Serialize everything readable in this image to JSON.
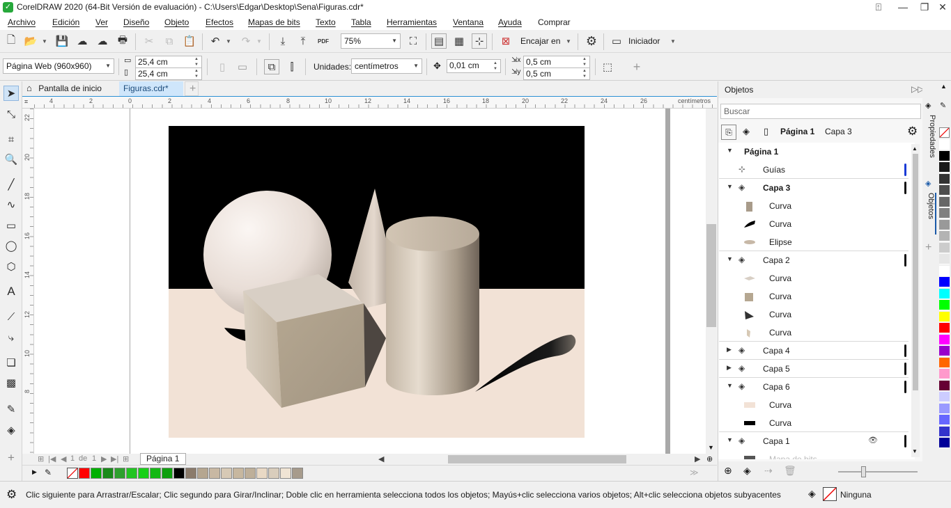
{
  "window": {
    "title": "CorelDRAW 2020 (64-Bit Versión de evaluación) - C:\\Users\\Edgar\\Desktop\\Sena\\Figuras.cdr*"
  },
  "menu": [
    "Archivo",
    "Edición",
    "Ver",
    "Diseño",
    "Objeto",
    "Efectos",
    "Mapas de bits",
    "Texto",
    "Tabla",
    "Herramientas",
    "Ventana",
    "Ayuda",
    "Comprar"
  ],
  "toolbar1": {
    "zoom": "75%",
    "snap_label": "Encajar en",
    "workspace_label": "Iniciador",
    "pdf_label": "PDF"
  },
  "toolbar2": {
    "page_preset": "Página Web (960x960)",
    "width": "25,4 cm",
    "height": "25,4 cm",
    "units_label": "Unidades:",
    "units_value": "centímetros",
    "nudge": "0,01 cm",
    "dup_x": "0,5 cm",
    "dup_y": "0,5 cm"
  },
  "doc_tabs": {
    "home": "Pantalla de inicio",
    "active": "Figuras.cdr*"
  },
  "ruler": {
    "h_labels": [
      "4",
      "2",
      "0",
      "2",
      "4",
      "6",
      "8",
      "10",
      "12",
      "14",
      "16",
      "18",
      "20",
      "22",
      "24",
      "26"
    ],
    "units": "centímetros",
    "v_labels": [
      "22",
      "20",
      "18",
      "16",
      "14",
      "12",
      "10",
      "8"
    ]
  },
  "page_nav": {
    "current": "1",
    "of": "de",
    "total": "1",
    "page_tab": "Página 1"
  },
  "objects_docker": {
    "title": "Objetos",
    "search_placeholder": "Buscar",
    "page_label": "Página 1",
    "layer_label": "Capa 3",
    "rows": [
      {
        "text": "Página 1",
        "level": 0,
        "twisty": "▼",
        "bold": true,
        "icon": ""
      },
      {
        "text": "Guías",
        "level": 1,
        "twisty": "",
        "bold": false,
        "icon": "guides-icon",
        "bar": "#1a3bd6"
      },
      {
        "text": "Capa 3",
        "level": 1,
        "twisty": "▼",
        "bold": true,
        "icon": "layer-icon",
        "bar": "#111111"
      },
      {
        "text": "Curva",
        "level": 2,
        "twisty": "",
        "bold": false,
        "icon": "curve-thumb-cylinder"
      },
      {
        "text": "Curva",
        "level": 2,
        "twisty": "",
        "bold": false,
        "icon": "curve-thumb-black"
      },
      {
        "text": "Elipse",
        "level": 2,
        "twisty": "",
        "bold": false,
        "icon": "ellipse-thumb"
      },
      {
        "text": "Capa 2",
        "level": 1,
        "twisty": "▼",
        "bold": false,
        "icon": "layer-icon",
        "bar": "#111111"
      },
      {
        "text": "Curva",
        "level": 2,
        "twisty": "",
        "bold": false,
        "icon": "curve-thumb-top"
      },
      {
        "text": "Curva",
        "level": 2,
        "twisty": "",
        "bold": false,
        "icon": "curve-thumb-cube"
      },
      {
        "text": "Curva",
        "level": 2,
        "twisty": "",
        "bold": false,
        "icon": "curve-thumb-triangle"
      },
      {
        "text": "Curva",
        "level": 2,
        "twisty": "",
        "bold": false,
        "icon": "curve-thumb-small"
      },
      {
        "text": "Capa 4",
        "level": 1,
        "twisty": "▶",
        "bold": false,
        "icon": "layer-icon",
        "bar": "#111111"
      },
      {
        "text": "Capa 5",
        "level": 1,
        "twisty": "▶",
        "bold": false,
        "icon": "layer-icon",
        "bar": "#111111"
      },
      {
        "text": "Capa 6",
        "level": 1,
        "twisty": "▼",
        "bold": false,
        "icon": "layer-icon",
        "bar": "#111111"
      },
      {
        "text": "Curva",
        "level": 2,
        "twisty": "",
        "bold": false,
        "icon": "curve-thumb-floor"
      },
      {
        "text": "Curva",
        "level": 2,
        "twisty": "",
        "bold": false,
        "icon": "curve-thumb-wall"
      },
      {
        "text": "Capa 1",
        "level": 1,
        "twisty": "▼",
        "bold": false,
        "icon": "layer-icon",
        "bar": "#111111"
      },
      {
        "text": "Mapa de bits",
        "level": 2,
        "twisty": "",
        "bold": false,
        "icon": "bitmap-thumb",
        "faded": true
      }
    ]
  },
  "side_tabs": {
    "properties": "Propiedades",
    "objects": "Objetos"
  },
  "status": {
    "hint": "Clic siguiente para Arrastrar/Escalar; Clic segundo para Girar/Inclinar; Doble clic en herramienta selecciona todos los objetos; Mayús+clic selecciona varios objetos; Alt+clic selecciona objetos subyacentes",
    "fill_label": "Ninguna"
  },
  "bottom_palette": [
    "#ff0000",
    "#00b000",
    "#1a8a1a",
    "#2ea02e",
    "#22c422",
    "#18d018",
    "#14b814",
    "#0f9f0f",
    "#000000",
    "#8b7b6b",
    "#b5a690",
    "#c8b8a3",
    "#d7c9b5",
    "#c7b79f",
    "#beaf99",
    "#e9d9c5",
    "#d9cdbc",
    "#f0e4d4",
    "#a79b8c"
  ],
  "right_palette": [
    "#ffffff",
    "#000000",
    "#1a1a1a",
    "#333333",
    "#4d4d4d",
    "#666666",
    "#808080",
    "#999999",
    "#b3b3b3",
    "#cccccc",
    "#e6e6e6",
    "#ffffff",
    "#0000ff",
    "#00ffff",
    "#00ff00",
    "#ffff00",
    "#ff0000",
    "#ff00ff",
    "#9900cc",
    "#ff6600",
    "#ff99cc",
    "#660033",
    "#ccccff",
    "#9999ff",
    "#6666ff",
    "#3333cc",
    "#000099"
  ]
}
